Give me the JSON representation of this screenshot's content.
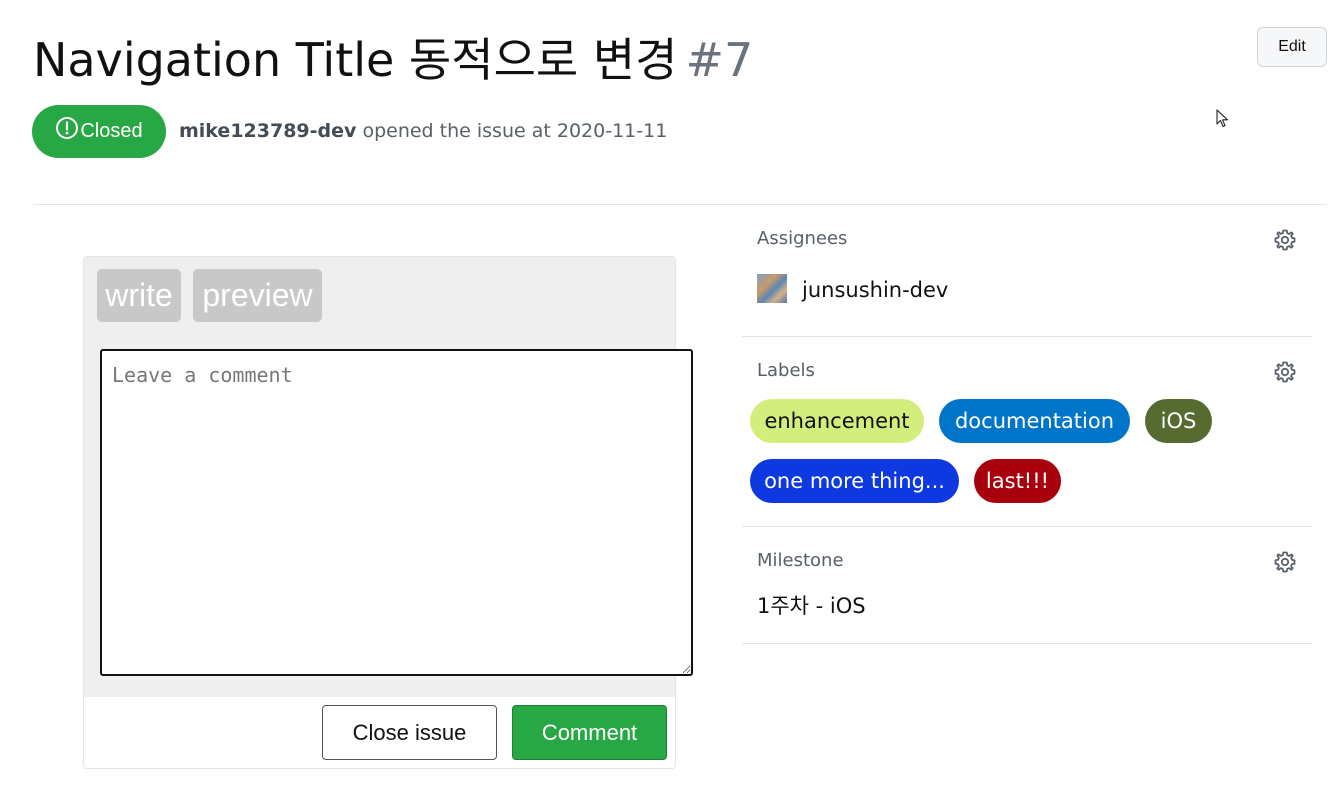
{
  "issue": {
    "title": "Navigation Title 동적으로 변경",
    "number": "#7",
    "edit_label": "Edit",
    "state": "Closed",
    "state_color": "#28a745",
    "author": "mike123789-dev",
    "opened_text": "opened the issue at 2020-11-11"
  },
  "editor": {
    "tabs": [
      "write",
      "preview"
    ],
    "placeholder": "Leave a comment",
    "value": "",
    "close_button": "Close issue",
    "comment_button": "Comment"
  },
  "sidebar": {
    "assignees": {
      "heading": "Assignees",
      "items": [
        {
          "name": "junsushin-dev"
        }
      ]
    },
    "labels": {
      "heading": "Labels",
      "items": [
        {
          "text": "enhancement",
          "color": "#d4ee7e",
          "text_color": "#111111"
        },
        {
          "text": "documentation",
          "color": "#0075ca",
          "text_color": "#ffffff"
        },
        {
          "text": "iOS",
          "color": "#556b2f",
          "text_color": "#ffffff"
        },
        {
          "text": "one more thing...",
          "color": "#0e38e0",
          "text_color": "#ffffff"
        },
        {
          "text": "last!!!",
          "color": "#a8000c",
          "text_color": "#ffffff"
        }
      ]
    },
    "milestone": {
      "heading": "Milestone",
      "value": "1주차 - iOS"
    }
  }
}
